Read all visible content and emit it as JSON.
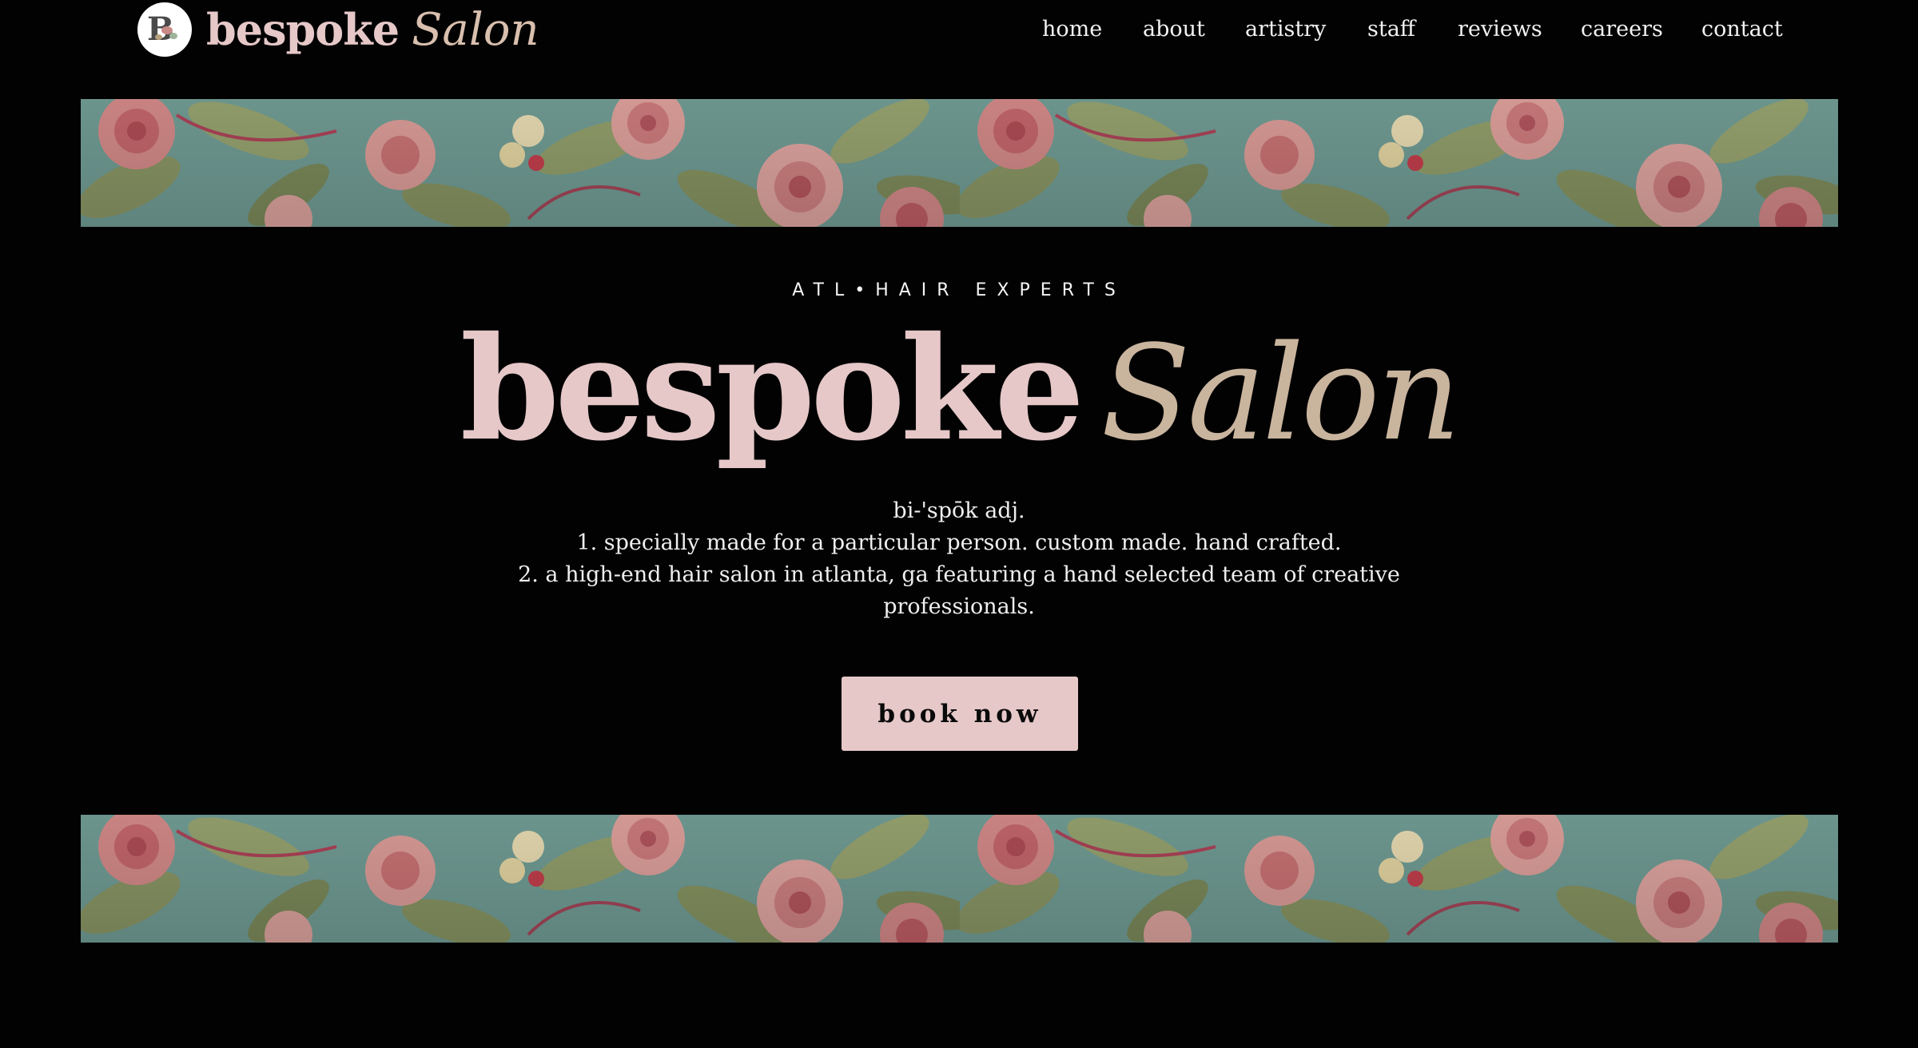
{
  "header": {
    "logo_icon": "salon-monogram-logo",
    "brand": {
      "word": "bespoke",
      "script": "Salon"
    },
    "nav": [
      {
        "label": "home"
      },
      {
        "label": "about"
      },
      {
        "label": "artistry"
      },
      {
        "label": "staff"
      },
      {
        "label": "reviews"
      },
      {
        "label": "careers"
      },
      {
        "label": "contact"
      }
    ]
  },
  "hero": {
    "tagline": "ATL•HAIR EXPERTS",
    "title": {
      "word": "bespoke",
      "script": "Salon"
    },
    "definition": [
      "bi-'spōk adj.",
      "1. specially made for a particular person. custom made. hand crafted.",
      "2. a high-end hair salon in atlanta, ga featuring a hand selected team of creative",
      "professionals."
    ],
    "cta_label": "book now"
  },
  "decor": {
    "band_pattern": "floral-rose-pattern",
    "colors": {
      "background": "#020202",
      "brand_pink": "#e6c8c9",
      "brand_tan": "#c9b49e",
      "band_teal": "#74a199"
    }
  }
}
